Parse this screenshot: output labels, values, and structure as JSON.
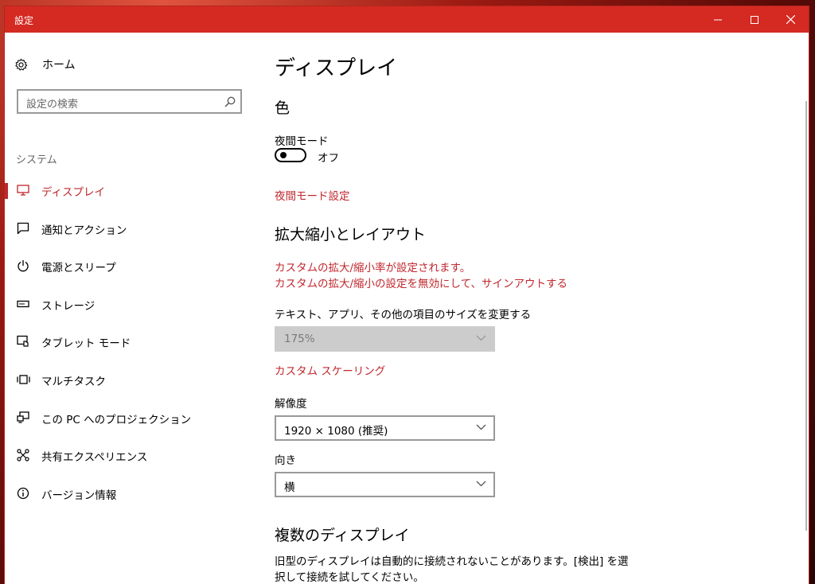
{
  "window": {
    "title": "設定"
  },
  "sidebar": {
    "home_label": "ホーム",
    "search_placeholder": "設定の検索",
    "section_label": "システム",
    "items": [
      {
        "label": "ディスプレイ",
        "icon": "monitor-icon",
        "active": true
      },
      {
        "label": "通知とアクション",
        "icon": "message-icon"
      },
      {
        "label": "電源とスリープ",
        "icon": "power-icon"
      },
      {
        "label": "ストレージ",
        "icon": "storage-icon"
      },
      {
        "label": "タブレット モード",
        "icon": "tablet-mode-icon"
      },
      {
        "label": "マルチタスク",
        "icon": "multitask-icon"
      },
      {
        "label": "この PC へのプロジェクション",
        "icon": "projection-icon"
      },
      {
        "label": "共有エクスペリエンス",
        "icon": "shared-experience-icon"
      },
      {
        "label": "バージョン情報",
        "icon": "info-icon"
      }
    ]
  },
  "main": {
    "page_title": "ディスプレイ",
    "color_heading": "色",
    "night_mode_label": "夜間モード",
    "night_mode_state": "オフ",
    "night_mode_settings_link": "夜間モード設定",
    "scale_heading": "拡大縮小とレイアウト",
    "custom_scale_warning_1": "カスタムの拡大/縮小率が設定されます。",
    "custom_scale_warning_2": "カスタムの拡大/縮小の設定を無効にして、サインアウトする",
    "text_size_label": "テキスト、アプリ、その他の項目のサイズを変更する",
    "scale_value": "175%",
    "custom_scaling_link": "カスタム スケーリング",
    "resolution_label": "解像度",
    "resolution_value": "1920 × 1080 (推奨)",
    "orientation_label": "向き",
    "orientation_value": "横",
    "multi_display_heading": "複数のディスプレイ",
    "multi_display_text": "旧型のディスプレイは自動的に接続されないことがあります。[検出] を選択して接続を試してください。"
  },
  "colors": {
    "accent": "#d42a22",
    "link": "#c0272d"
  }
}
